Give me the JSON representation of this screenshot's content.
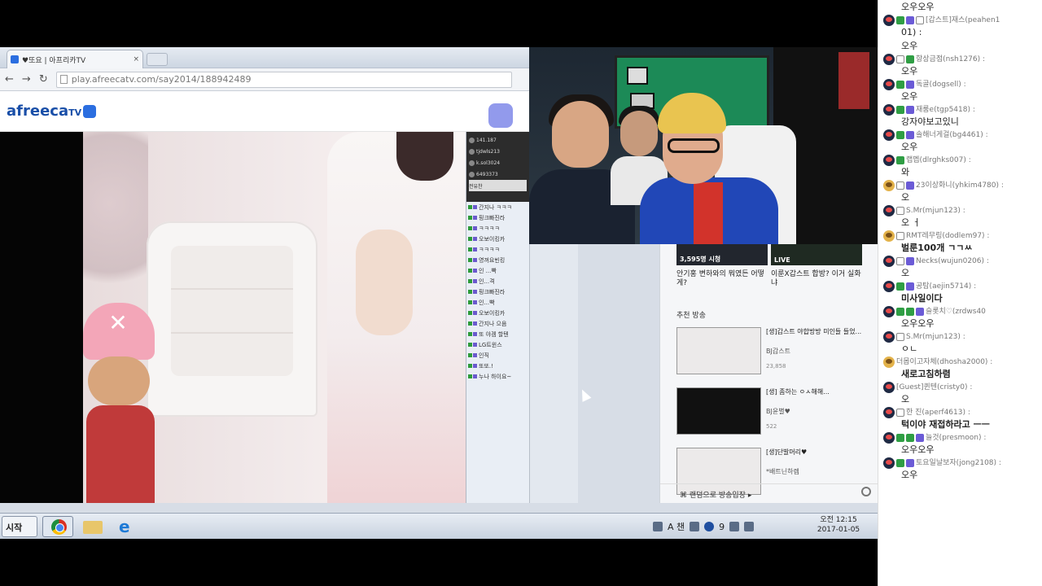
{
  "browser": {
    "tab_title": "♥또요 | 아프리카TV",
    "tab_close": "×",
    "url": "play.afreecatv.com/say2014/188942489",
    "logo": "afreeca",
    "logo_tv": "TV",
    "watermark": "afreecaTV",
    "nav_back": "←",
    "nav_forward": "→",
    "nav_reload": "↻"
  },
  "inner_chat": {
    "top_rows": [
      "141.187",
      "tjdwls213",
      "k.sol3024",
      "6493373"
    ],
    "tab_label": "전유찬",
    "messages": [
      "간지나 ㅋㅋㅋ",
      "핑크빠진라",
      "ㅋㅋㅋㅋ",
      "오보이킹카",
      "ㅋㅋㅋㅋ",
      "영꺼요빈킹",
      "인 ...빡",
      "인...격",
      "핑크빠진라",
      "인...빡",
      "오보이킹카",
      "간지나 으음",
      "또 야겜 할텐",
      "LG트윈스",
      "인직",
      "또또.!",
      "누나 하이요~"
    ]
  },
  "page_right": {
    "thumbs": [
      {
        "label": "3,595명 시청"
      },
      {
        "label": "LIVE"
      }
    ],
    "titles": [
      "안기홍 변하와의 뭐였든 어떻게?",
      "이룬X갑스트 합방? 이거 실화냐"
    ],
    "section": "추천 방송",
    "recs": [
      {
        "title": "[생]갑스트 야합방방 미인들 들었...",
        "sub": "BJ갑스트",
        "views": "23,858"
      },
      {
        "title": "[생] 좀하는 ㅇㅅ해해...",
        "sub": "BJ윤별♥",
        "views": "522"
      },
      {
        "title": "[생]단발머리♥",
        "sub": "*배트닌하렘",
        "views": ""
      }
    ],
    "more": "⌘ 랜덤으로 방송입장 ▸"
  },
  "taskbar": {
    "start": "시작",
    "tray_text": "A 챈",
    "tray_num": "9",
    "clock_time": "오전 12:15",
    "clock_date": "2017-01-05"
  },
  "chat": {
    "messages": [
      {
        "name": "",
        "text": "오우오우",
        "bold": false,
        "badges": []
      },
      {
        "name": "[갑스트]재스(peahen1",
        "text": "01) :",
        "bold": false,
        "badges": [
          "g",
          "p",
          "o"
        ]
      },
      {
        "name": "",
        "text": "오우",
        "bold": false,
        "badges": []
      },
      {
        "name": "항상금점(nsh1276) :",
        "text": "오우",
        "bold": false,
        "badges": [
          "o",
          "g"
        ]
      },
      {
        "name": "독골(dogsell) :",
        "text": "오우",
        "bold": false,
        "badges": [
          "g",
          "p"
        ]
      },
      {
        "name": "재룸e(tgp5418) :",
        "text": "강자야보고있니",
        "bold": false,
        "badges": [
          "g",
          "p"
        ]
      },
      {
        "name": "솔해너게걸(bg4461) :",
        "text": "오우",
        "bold": false,
        "badges": [
          "g",
          "p"
        ]
      },
      {
        "name": "랩멥(dlrghks007) :",
        "text": "와",
        "bold": false,
        "badges": [
          "g"
        ]
      },
      {
        "name": "23이상화니(yhkim4780) :",
        "text": "오",
        "bold": false,
        "badges": [
          "o",
          "p"
        ],
        "gold": true
      },
      {
        "name": "S.Mr(mjun123) :",
        "text": "오 ㅓ",
        "bold": false,
        "badges": [
          "o"
        ]
      },
      {
        "name": "RMT레무링(dodlem97) :",
        "text": "벌룬100개 ㄱㄱㅆ",
        "bold": true,
        "badges": [
          "o"
        ],
        "gold": true
      },
      {
        "name": "Necks(wujun0206) :",
        "text": "오",
        "bold": false,
        "badges": [
          "o",
          "p"
        ]
      },
      {
        "name": "공탐(aejin5714) :",
        "text": "미사일이다",
        "bold": true,
        "badges": [
          "g",
          "p"
        ]
      },
      {
        "name": "슬롯치♡(zrdws40",
        "text": "오우오우",
        "bold": false,
        "badges": [
          "g",
          "g",
          "p"
        ]
      },
      {
        "name": "S.Mr(mjun123) :",
        "text": "ㅇㄴ",
        "bold": false,
        "badges": [
          "o"
        ]
      },
      {
        "name": "더몹이고자체(dhosha2000) :",
        "text": "새로고침하렴",
        "bold": true,
        "badges": [],
        "gold": true
      },
      {
        "name": "[Guest]퀸텐(cristy0) :",
        "text": "오",
        "bold": false,
        "badges": []
      },
      {
        "name": "한 진(aperf4613) :",
        "text": "턱이야 재접하라고 ㅡㅡ",
        "bold": true,
        "badges": [
          "o"
        ]
      },
      {
        "name": "늘것(presmoon) :",
        "text": "오우오우",
        "bold": false,
        "badges": [
          "g",
          "g",
          "p"
        ]
      },
      {
        "name": "토요일날보자(jong2108) :",
        "text": "오우",
        "bold": false,
        "badges": [
          "g",
          "p"
        ]
      }
    ]
  }
}
